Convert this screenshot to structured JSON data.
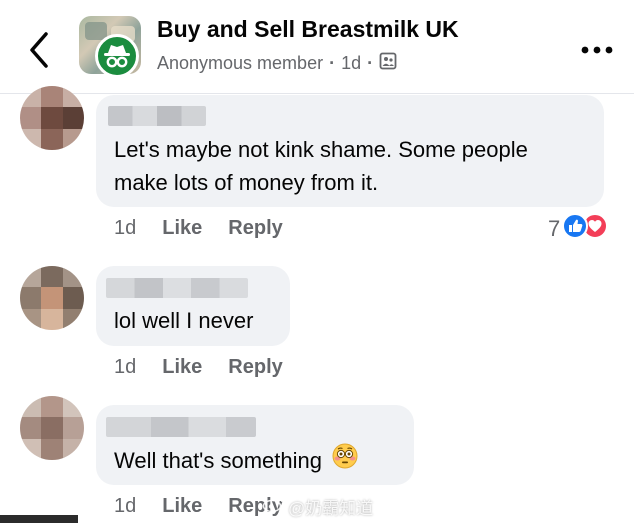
{
  "header": {
    "title": "Buy and Sell Breastmilk UK",
    "author": "Anonymous member",
    "time": "1d"
  },
  "comments": [
    {
      "text_lines": [
        "Let's maybe not kink shame. Some people",
        "make lots of money from it."
      ],
      "time": "1d",
      "like_label": "Like",
      "reply_label": "Reply",
      "reaction_count": "7",
      "reactions": [
        "like-icon",
        "love-icon"
      ]
    },
    {
      "text_lines": [
        "lol well I never"
      ],
      "time": "1d",
      "like_label": "Like",
      "reply_label": "Reply"
    },
    {
      "text_lines": [
        "Well that's something"
      ],
      "emoji": "flushed-face-emoji",
      "time": "1d",
      "like_label": "Like",
      "reply_label": "Reply"
    }
  ],
  "watermark": "@奶霸知道",
  "colors": {
    "bubble": "#f0f2f5",
    "secondary_text": "#65676b",
    "anon_badge": "#1b8c3f",
    "like_blue": "#1877f2",
    "love_red": "#f33e58"
  }
}
